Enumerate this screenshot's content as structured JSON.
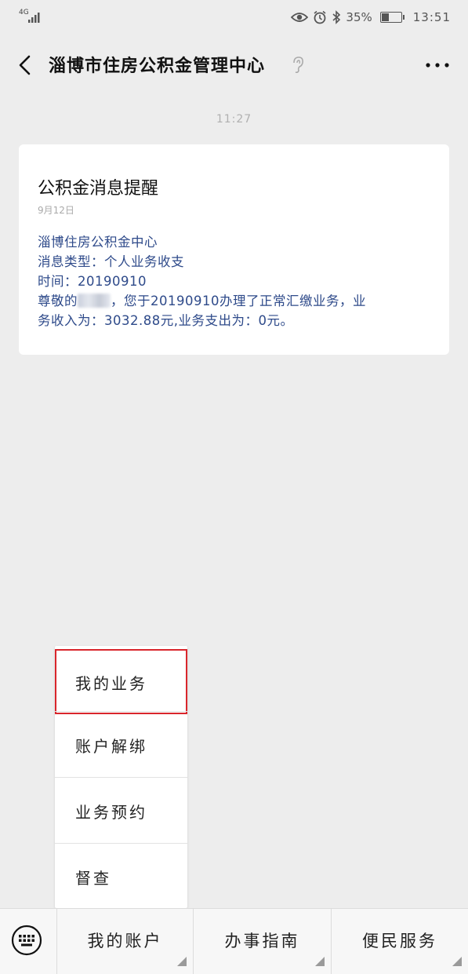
{
  "status_bar": {
    "network": "4G",
    "battery": "35%",
    "time": "13:51"
  },
  "header": {
    "title": "淄博市住房公积金管理中心"
  },
  "chat": {
    "timestamp": "11:27",
    "card": {
      "title": "公积金消息提醒",
      "date": "9月12日",
      "org": "淄博住房公积金中心",
      "type_line": "消息类型：个人业务收支",
      "time_line": "时间：20190910",
      "greeting_prefix": "尊敬的",
      "greeting_rest": "，您于20190910办理了正常汇缴业务，业",
      "line_last": "务收入为：3032.88元,业务支出为：0元。"
    }
  },
  "popup_menu": {
    "items": [
      "我的业务",
      "账户解绑",
      "业务预约",
      "督查"
    ]
  },
  "bottom_menu": {
    "items": [
      "我的账户",
      "办事指南",
      "便民服务"
    ]
  }
}
